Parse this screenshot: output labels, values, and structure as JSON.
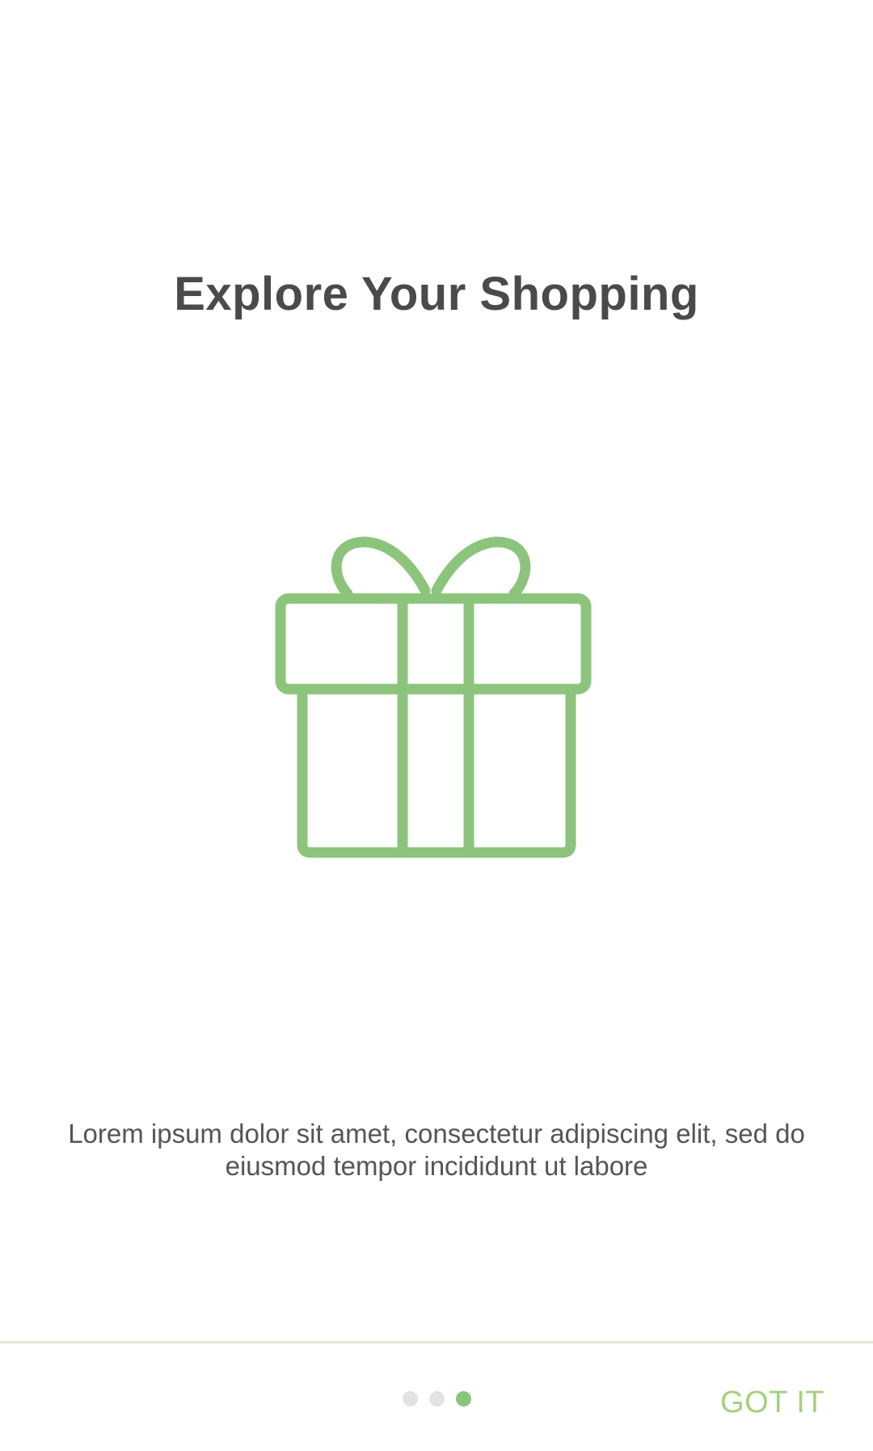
{
  "screen": {
    "title": "Explore Your Shopping",
    "illustration_icon": "gift-icon",
    "description": "Lorem ipsum dolor sit amet, consectetur adipiscing elit, sed do eiusmod tempor incididunt ut labore"
  },
  "pager": {
    "total": 3,
    "current": 3
  },
  "actions": {
    "got_it_label": "GOT IT"
  },
  "colors": {
    "accent_green": "#8cc47c",
    "button_text": "#a4d17e",
    "title_text": "#4a4a4a",
    "body_text": "#555555",
    "dot_inactive": "#e3e3e3",
    "divider": "#dfe8d5"
  }
}
